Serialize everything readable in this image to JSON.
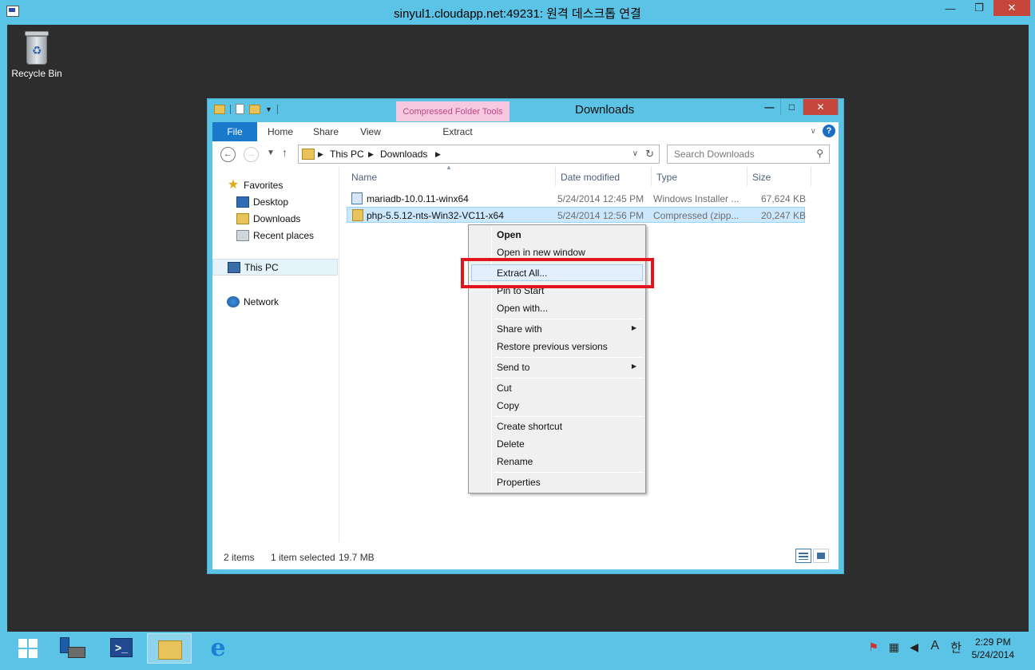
{
  "rdp": {
    "title": "sinyul1.cloudapp.net:49231: 원격 데스크톱 연결",
    "minimize": "—",
    "restore": "❐",
    "close": "✕"
  },
  "desktop": {
    "recycle_bin_label": "Recycle Bin"
  },
  "explorer": {
    "title": "Downloads",
    "contextual_tab_group": "Compressed Folder Tools",
    "ribbon_tabs": [
      "File",
      "Home",
      "Share",
      "View",
      "Extract"
    ],
    "address": {
      "crumbs": [
        "This PC",
        "Downloads"
      ]
    },
    "search_placeholder": "Search Downloads",
    "nav_pane": {
      "favorites": "Favorites",
      "desktop": "Desktop",
      "downloads": "Downloads",
      "recent_places": "Recent places",
      "this_pc": "This PC",
      "network": "Network"
    },
    "columns": [
      "Name",
      "Date modified",
      "Type",
      "Size"
    ],
    "files": [
      {
        "name": "mariadb-10.0.11-winx64",
        "date": "5/24/2014 12:45 PM",
        "type": "Windows Installer ...",
        "size": "67,624 KB",
        "icon": "msi-icon",
        "selected": false
      },
      {
        "name": "php-5.5.12-nts-Win32-VC11-x64",
        "date": "5/24/2014 12:56 PM",
        "type": "Compressed (zipp...",
        "size": "20,247 KB",
        "icon": "zip-folder-icon",
        "selected": true
      }
    ],
    "status": {
      "items": "2 items",
      "selected": "1 item selected",
      "size": "19.7 MB"
    }
  },
  "context_menu": {
    "items": [
      {
        "label": "Open",
        "bold": true
      },
      {
        "label": "Open in new window"
      },
      {
        "label": "Extract All...",
        "highlighted": true
      },
      {
        "label": "Pin to Start"
      },
      {
        "label": "Open with..."
      },
      {
        "label": "Share with",
        "submenu": true
      },
      {
        "label": "Restore previous versions"
      },
      {
        "label": "Send to",
        "submenu": true
      },
      {
        "label": "Cut"
      },
      {
        "label": "Copy"
      },
      {
        "label": "Create shortcut"
      },
      {
        "label": "Delete"
      },
      {
        "label": "Rename"
      },
      {
        "label": "Properties"
      }
    ],
    "highlight_color": "#e3141b"
  },
  "taskbar": {
    "apps": [
      "start",
      "server-manager",
      "powershell",
      "file-explorer",
      "internet-explorer"
    ],
    "tray": {
      "ime_mode": "A",
      "ime_lang": "한",
      "time": "2:29 PM",
      "date": "5/24/2014"
    }
  }
}
